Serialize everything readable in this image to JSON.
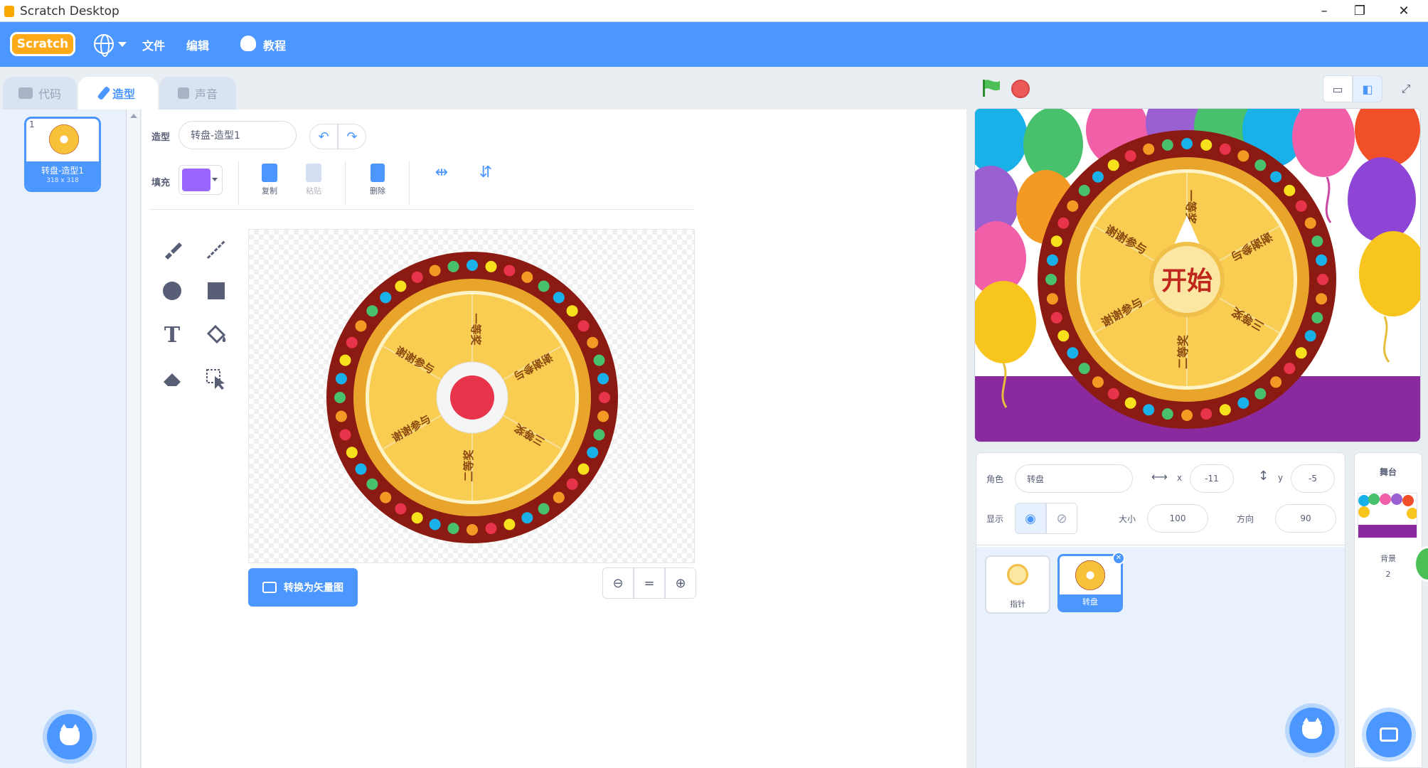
{
  "window": {
    "title": "Scratch Desktop",
    "controls": [
      "–",
      "❐",
      "✕"
    ]
  },
  "menubar": {
    "logo": "Scratch",
    "file": "文件",
    "edit": "编辑",
    "tutorials": "教程"
  },
  "tabs": [
    {
      "label": "代码",
      "active": false
    },
    {
      "label": "造型",
      "active": true
    },
    {
      "label": "声音",
      "active": false
    }
  ],
  "costume_list": {
    "items": [
      {
        "number": "1",
        "name": "转盘-造型1",
        "size": "318 x 318"
      }
    ]
  },
  "paint_editor": {
    "costume_label": "造型",
    "costume_name": "转盘-造型1",
    "fill_label": "填充",
    "fill_color": "#9966ff",
    "copy_label": "复制",
    "paste_label": "粘贴",
    "delete_label": "删除",
    "convert_label": "转换为矢量图",
    "zoom_reset": "="
  },
  "wheel": {
    "center_text": "开始",
    "segments": [
      "一等奖",
      "谢谢参与",
      "三等奖",
      "二等奖",
      "谢谢参与",
      "谢谢参与"
    ],
    "colors": {
      "rim": "#8b1a12",
      "face": "#f9cd52",
      "ring": "#e9a42c",
      "hub": "#e8344a"
    }
  },
  "sprite_info": {
    "sprite_label": "角色",
    "sprite_name": "转盘",
    "x_label": "x",
    "x_value": "-11",
    "y_label": "y",
    "y_value": "-5",
    "show_label": "显示",
    "size_label": "大小",
    "size_value": "100",
    "direction_label": "方向",
    "direction_value": "90"
  },
  "sprites": [
    {
      "name": "指针",
      "selected": false
    },
    {
      "name": "转盘",
      "selected": true
    }
  ],
  "stage_target": {
    "title": "舞台",
    "backdrops_label": "背景",
    "backdrops_count": "2"
  },
  "accent_colors": {
    "primary": "#4c97ff",
    "stage_floor": "#8a2a9e"
  }
}
